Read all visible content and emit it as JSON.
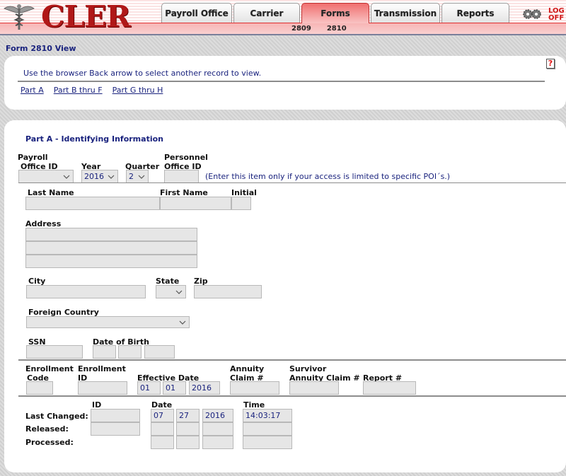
{
  "header": {
    "logo_text": "CLER",
    "tabs": [
      {
        "label": "Payroll Office",
        "active": false
      },
      {
        "label": "Carrier",
        "active": false
      },
      {
        "label": "Forms",
        "active": true
      },
      {
        "label": "Transmission",
        "active": false
      },
      {
        "label": "Reports",
        "active": false
      }
    ],
    "subtabs": [
      "2809",
      "2810"
    ],
    "logoff_line1": "LOG",
    "logoff_line2": "OFF",
    "icons": {
      "logo": "caduceus-icon",
      "settings": "gear-icon"
    }
  },
  "page_title": "Form 2810 View",
  "nav_panel": {
    "instruction": "Use the browser Back arrow to select another record to view.",
    "help_icon": "?",
    "links": [
      "Part A",
      "Part B thru F",
      "Part G thru H"
    ]
  },
  "part_a": {
    "title": "Part A - Identifying Information",
    "payroll_office_id": {
      "label_line1": "Payroll",
      "label_line2": "Office ID",
      "value": ""
    },
    "year": {
      "label": "Year",
      "value": "2016"
    },
    "quarter": {
      "label": "Quarter",
      "value": "2"
    },
    "personnel_office_id": {
      "label_line1": "Personnel",
      "label_line2": "Office ID",
      "value": ""
    },
    "poi_note": "(Enter this item only if your access is limited to specific POI´s.)",
    "last_name": {
      "label": "Last Name",
      "value": ""
    },
    "first_name": {
      "label": "First Name",
      "value": ""
    },
    "initial": {
      "label": "Initial",
      "value": ""
    },
    "address": {
      "label": "Address",
      "lines": [
        "",
        "",
        ""
      ]
    },
    "city": {
      "label": "City",
      "value": ""
    },
    "state": {
      "label": "State",
      "value": ""
    },
    "zip": {
      "label": "Zip",
      "value": ""
    },
    "foreign_country": {
      "label": "Foreign Country",
      "value": ""
    },
    "ssn": {
      "label": "SSN",
      "value": ""
    },
    "date_of_birth": {
      "label": "Date of Birth",
      "month": "",
      "day": "",
      "year": ""
    },
    "enrollment_code": {
      "label_line1": "Enrollment",
      "label_line2": "Code",
      "value": ""
    },
    "enrollment_id": {
      "label_line1": "Enrollment",
      "label_line2": "ID",
      "value": ""
    },
    "effective_date": {
      "label": "Effective Date",
      "month": "01",
      "day": "01",
      "year": "2016"
    },
    "annuity_claim": {
      "label_line1": "Annuity",
      "label_line2": "Claim #",
      "value": ""
    },
    "survivor_annuity_claim": {
      "label_line1": "Survivor",
      "label_line2": "Annuity Claim #",
      "value": ""
    },
    "report_number": {
      "label": "Report #",
      "value": ""
    }
  },
  "audit": {
    "col_id": "ID",
    "col_date": "Date",
    "col_time": "Time",
    "rows": [
      {
        "label": "Last Changed:",
        "id": "",
        "month": "07",
        "day": "27",
        "year": "2016",
        "time": "14:03:17"
      },
      {
        "label": "Released:",
        "id": "",
        "month": "",
        "day": "",
        "year": "",
        "time": ""
      },
      {
        "label": "Processed:",
        "month": "",
        "day": "",
        "year": "",
        "time": ""
      }
    ]
  }
}
